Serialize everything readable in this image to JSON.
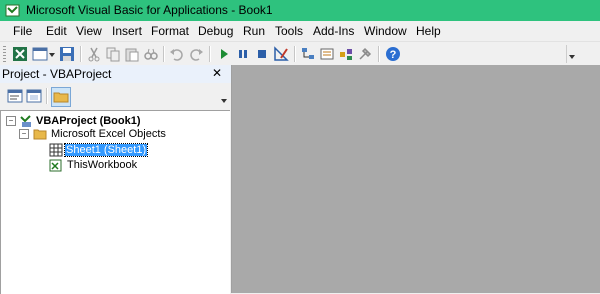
{
  "window": {
    "title": "Microsoft Visual Basic for Applications - Book1"
  },
  "menu": [
    {
      "label": "File"
    },
    {
      "label": "Edit"
    },
    {
      "label": "View"
    },
    {
      "label": "Insert"
    },
    {
      "label": "Format"
    },
    {
      "label": "Debug"
    },
    {
      "label": "Run"
    },
    {
      "label": "Tools"
    },
    {
      "label": "Add-Ins"
    },
    {
      "label": "Window"
    },
    {
      "label": "Help"
    }
  ],
  "toolbar": {
    "icons": [
      "view-excel-icon",
      "insert-userform-icon",
      "save-icon",
      "cut-icon",
      "copy-icon",
      "paste-icon",
      "find-icon",
      "undo-icon",
      "redo-icon",
      "run-icon",
      "break-icon",
      "reset-icon",
      "design-mode-icon",
      "project-explorer-icon",
      "properties-icon",
      "object-browser-icon",
      "toolbox-icon",
      "help-icon"
    ]
  },
  "project_panel": {
    "title": "Project - VBAProject",
    "close": "✕",
    "buttons": [
      "view-code-icon",
      "view-object-icon",
      "toggle-folders-icon"
    ]
  },
  "tree": {
    "root": {
      "label": "VBAProject (Book1)",
      "expander": "−"
    },
    "folder": {
      "label": "Microsoft Excel Objects",
      "expander": "−"
    },
    "items": [
      {
        "label": "Sheet1 (Sheet1)",
        "selected": true
      },
      {
        "label": "ThisWorkbook",
        "selected": false
      }
    ]
  },
  "colors": {
    "titlebar": "#2ec27e",
    "workspace": "#a9a9a9",
    "selection": "#3399ff"
  }
}
